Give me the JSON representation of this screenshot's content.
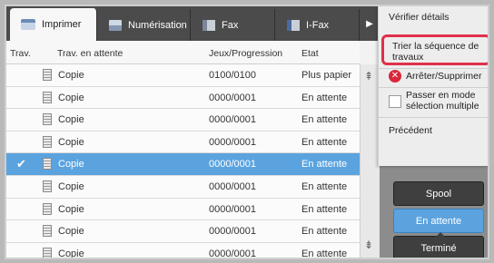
{
  "tabs": [
    {
      "label": "Imprimer",
      "icon": "printer-icon",
      "active": true
    },
    {
      "label": "Numérisation",
      "icon": "scan-icon",
      "active": false
    },
    {
      "label": "Fax",
      "icon": "fax-icon",
      "active": false
    },
    {
      "label": "I-Fax",
      "icon": "ifax-icon",
      "active": false
    }
  ],
  "table": {
    "headers": {
      "trav": "Trav.",
      "waiting": "Trav. en attente",
      "progress": "Jeux/Progression",
      "state": "Etat"
    },
    "rows": [
      {
        "name": "Copie",
        "progress": "0100/0100",
        "state": "Plus papier",
        "selected": false
      },
      {
        "name": "Copie",
        "progress": "0000/0001",
        "state": "En attente",
        "selected": false
      },
      {
        "name": "Copie",
        "progress": "0000/0001",
        "state": "En attente",
        "selected": false
      },
      {
        "name": "Copie",
        "progress": "0000/0001",
        "state": "En attente",
        "selected": false
      },
      {
        "name": "Copie",
        "progress": "0000/0001",
        "state": "En attente",
        "selected": true
      },
      {
        "name": "Copie",
        "progress": "0000/0001",
        "state": "En attente",
        "selected": false
      },
      {
        "name": "Copie",
        "progress": "0000/0001",
        "state": "En attente",
        "selected": false
      },
      {
        "name": "Copie",
        "progress": "0000/0001",
        "state": "En attente",
        "selected": false
      },
      {
        "name": "Copie",
        "progress": "0000/0001",
        "state": "En attente",
        "selected": false
      }
    ]
  },
  "menu": {
    "verify": "Vérifier détails",
    "sort": "Trier la séquence de travaux",
    "stop": "Arrêter/Supprimer",
    "multi": "Passer en mode sélection multiple",
    "prev": "Précédent"
  },
  "status_buttons": {
    "spool": "Spool",
    "waiting": "En attente",
    "done": "Terminé"
  },
  "colors": {
    "selected_row": "#5ba3df",
    "highlight_border": "#e0304a",
    "stop_icon": "#d9283a"
  }
}
